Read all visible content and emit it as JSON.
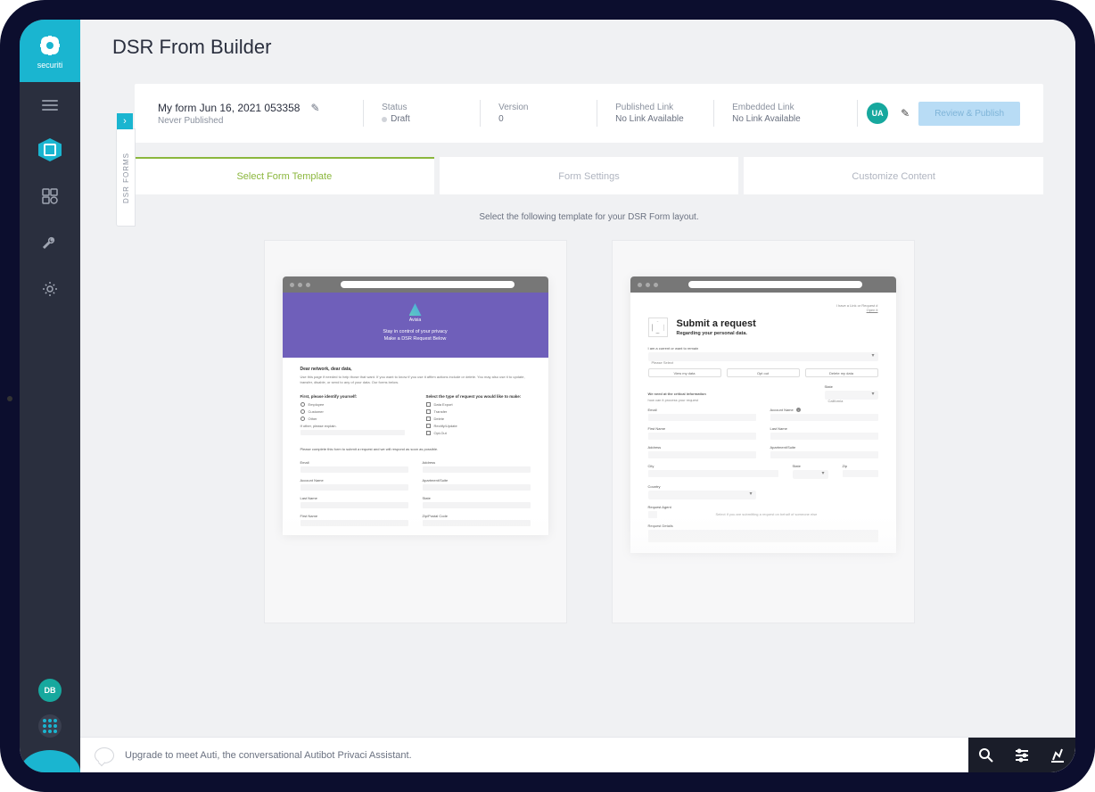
{
  "brand": {
    "name": "securiti"
  },
  "page": {
    "title": "DSR From Builder"
  },
  "sidebar": {
    "avatar": "DB",
    "tab_label": "DSR FORMS"
  },
  "info_bar": {
    "form_name": "My form Jun 16, 2021 053358",
    "form_status_sub": "Never Published",
    "status": {
      "label": "Status",
      "value": "Draft"
    },
    "version": {
      "label": "Version",
      "value": "0"
    },
    "published_link": {
      "label": "Published Link",
      "value": "No Link Available"
    },
    "embedded_link": {
      "label": "Embedded Link",
      "value": "No Link Available"
    },
    "user_badge": "UA",
    "publish_btn": "Review & Publish"
  },
  "tabs": {
    "t1": "Select Form Template",
    "t2": "Form Settings",
    "t3": "Customize Content"
  },
  "template_hint": "Select the following template for your DSR Form layout.",
  "template1": {
    "brand": "Avisia",
    "hero_line1": "Stay in control of your privacy",
    "hero_line2": "Make a DSR Request Below",
    "section_title": "Dear network, dear data,",
    "section_desc": "Use this page if needed to help those that want. If you want to know if you use it affirm actions include or delete. You may also use it to update, transfer, disable, or send to any of your data. Our forms below.",
    "col1_title": "First, please identify yourself:",
    "col1_opt1": "Employee",
    "col1_opt2": "Customer",
    "col1_opt3": "Other",
    "col1_other": "If other, please explain.",
    "col2_title": "Select the type of request you would like to make:",
    "col2_opt1": "Data Export",
    "col2_opt2": "Transfer",
    "col2_opt3": "Delete",
    "col2_opt4": "Rectify/Update",
    "col2_opt5": "Opt-Out",
    "instruction": "Please complete this form to submit a request and we will respond as soon as possible.",
    "f1": "Email",
    "f2": "Address",
    "f3": "Account Name",
    "f4": "Apartment/Suite",
    "f5": "Last Name",
    "f6": "State",
    "f7": "First Name",
    "f8": "Zip/Postal Code"
  },
  "template2": {
    "corner1": "I have a Link or Request #",
    "corner2": "Open it",
    "title": "Submit a request",
    "subtitle": "Regarding your personal data.",
    "label_iam": "I am a current or want to remain",
    "select_val": "Please Select",
    "tab1": "View my data",
    "tab2": "Opt out",
    "tab3": "Delete my data",
    "text1": "We need at the critical information",
    "text2": "how can it process your request",
    "state_label": "State",
    "state_val": "California",
    "f_email": "Email",
    "f_account": "Account Name",
    "f_firstname": "First Name",
    "f_lastname": "Last Name",
    "f_address": "Address",
    "f_apt": "Apartment/Suite",
    "f_city": "City",
    "f_state": "State",
    "f_zip": "Zip",
    "f_country": "Country",
    "f_agent": "Request Agent",
    "agent_hint": "Select if you are submitting a request on behalf of someone else",
    "f_details": "Request Details"
  },
  "bottom": {
    "text": "Upgrade to meet Auti, the conversational Autibot Privaci Assistant."
  }
}
